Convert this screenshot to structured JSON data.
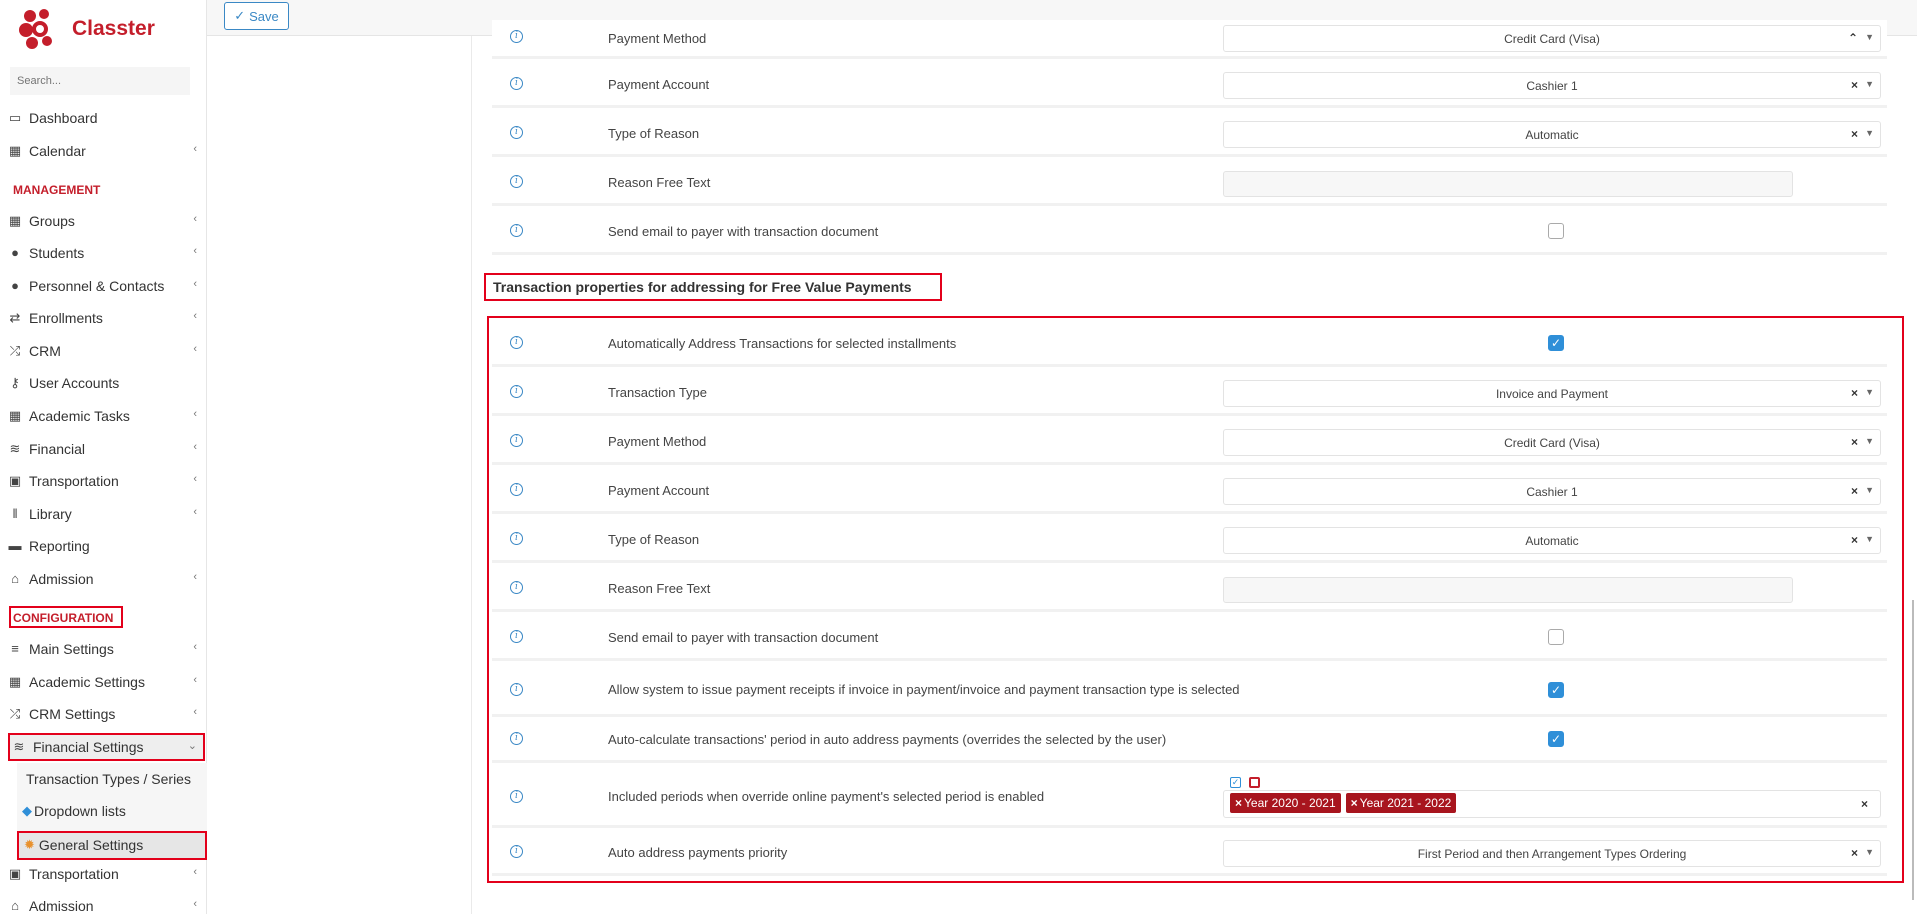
{
  "app": {
    "name": "Classter"
  },
  "sidebar": {
    "search_placeholder": "Search...",
    "items_top": [
      {
        "label": "Dashboard",
        "icon": "laptop-icon"
      },
      {
        "label": "Calendar",
        "icon": "calendar-icon"
      }
    ],
    "management_label": "MANAGEMENT",
    "management_items": [
      {
        "label": "Groups",
        "icon": "groups-icon"
      },
      {
        "label": "Students",
        "icon": "students-icon"
      },
      {
        "label": "Personnel & Contacts",
        "icon": "person-icon"
      },
      {
        "label": "Enrollments",
        "icon": "exchange-icon"
      },
      {
        "label": "CRM",
        "icon": "shuffle-icon"
      },
      {
        "label": "User Accounts",
        "icon": "key-icon"
      },
      {
        "label": "Academic Tasks",
        "icon": "grid-icon"
      },
      {
        "label": "Financial",
        "icon": "coins-icon"
      },
      {
        "label": "Transportation",
        "icon": "bus-icon"
      },
      {
        "label": "Library",
        "icon": "books-icon"
      },
      {
        "label": "Reporting",
        "icon": "printer-icon"
      },
      {
        "label": "Admission",
        "icon": "institution-icon"
      }
    ],
    "configuration_label": "CONFIGURATION",
    "configuration_items": [
      {
        "label": "Main Settings",
        "icon": "sliders-icon"
      },
      {
        "label": "Academic Settings",
        "icon": "groups-icon"
      },
      {
        "label": "CRM Settings",
        "icon": "shuffle-icon"
      },
      {
        "label": "Financial Settings",
        "icon": "coins-icon"
      }
    ],
    "financial_sub": [
      {
        "label": "Transaction Types / Series"
      },
      {
        "label": "Dropdown lists"
      },
      {
        "label": "General Settings"
      }
    ],
    "bottom_items": [
      {
        "label": "Transportation",
        "icon": "bus-icon"
      },
      {
        "label": "Admission",
        "icon": "institution-icon"
      }
    ]
  },
  "toolbar": {
    "save_label": "Save"
  },
  "upper_rows": [
    {
      "label": "Payment Method",
      "value": "Credit Card (Visa)"
    },
    {
      "label": "Payment Account",
      "value": "Cashier 1"
    },
    {
      "label": "Type of Reason",
      "value": "Automatic"
    },
    {
      "label": "Reason Free Text",
      "value": ""
    },
    {
      "label": "Send email to payer with transaction document",
      "checked": false
    }
  ],
  "section_title": "Transaction properties for addressing for Free Value Payments",
  "section_rows": [
    {
      "label": "Automatically Address Transactions for selected installments",
      "checked": true
    },
    {
      "label": "Transaction Type",
      "value": "Invoice and Payment"
    },
    {
      "label": "Payment Method",
      "value": "Credit Card (Visa)"
    },
    {
      "label": "Payment Account",
      "value": "Cashier 1"
    },
    {
      "label": "Type of Reason",
      "value": "Automatic"
    },
    {
      "label": "Reason Free Text",
      "value": ""
    },
    {
      "label": "Send email to payer with transaction document",
      "checked": false
    },
    {
      "label": "Allow system to issue payment receipts if invoice in payment/invoice and payment transaction type is selected",
      "checked": true
    },
    {
      "label": "Auto-calculate transactions' period in auto address payments (overrides the selected by the user)",
      "checked": true
    },
    {
      "label": "Included periods when override online payment's selected period is enabled",
      "tags": [
        "Year 2020 - 2021",
        "Year 2021 - 2022"
      ]
    },
    {
      "label": "Auto address payments priority",
      "value": "First Period and then Arrangement Types Ordering"
    }
  ],
  "colors": {
    "brand": "#c41e2b",
    "accent": "#2f8fd8",
    "highlight": "#e3001b",
    "tag": "#a8151e"
  }
}
